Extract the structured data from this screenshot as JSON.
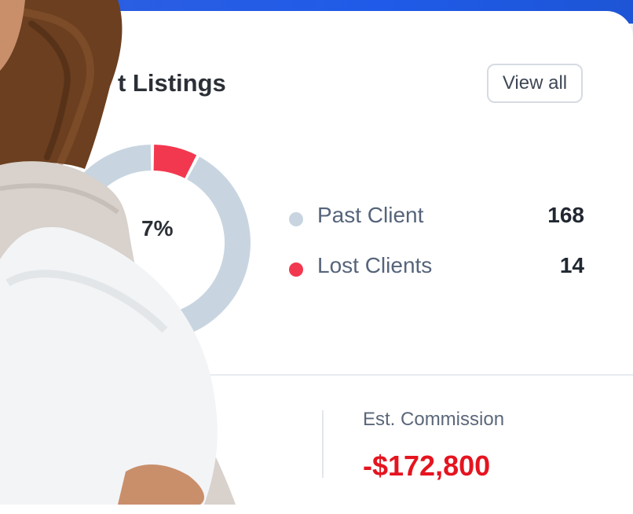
{
  "card": {
    "title": "t Listings",
    "view_all_label": "View all"
  },
  "donut": {
    "center_label": "7%"
  },
  "chart_data": {
    "type": "pie",
    "categories": [
      "Past Client",
      "Lost Clients"
    ],
    "values": [
      168,
      14
    ],
    "colors": [
      "#c8d5e0",
      "#f2384f"
    ]
  },
  "legend": [
    {
      "label": "Past Client",
      "value": "168",
      "color": "#c8d5e0"
    },
    {
      "label": "Lost Clients",
      "value": "14",
      "color": "#f2384f"
    }
  ],
  "stats": {
    "est_commission_label": "Est. Commission",
    "est_commission_value": "-$172,800"
  },
  "colors": {
    "topbar": "#1f5be8",
    "accent_negative": "#e5141f"
  }
}
